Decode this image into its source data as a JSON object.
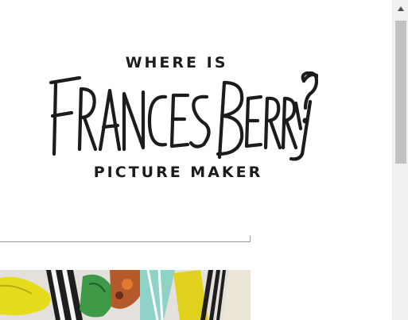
{
  "header": {
    "kicker_top": "WHERE IS",
    "title_script": "Frances Berry?",
    "kicker_bottom": "PICTURE MAKER"
  },
  "colors": {
    "ink": "#1c1c1c",
    "background": "#ffffff",
    "scrollbar_track": "#f1f1f1",
    "scrollbar_thumb": "#c1c1c1",
    "art_yellow": "#e6dc1e",
    "art_teal": "#8fd3c8"
  },
  "icons": {
    "scroll_up": "triangle-up"
  }
}
